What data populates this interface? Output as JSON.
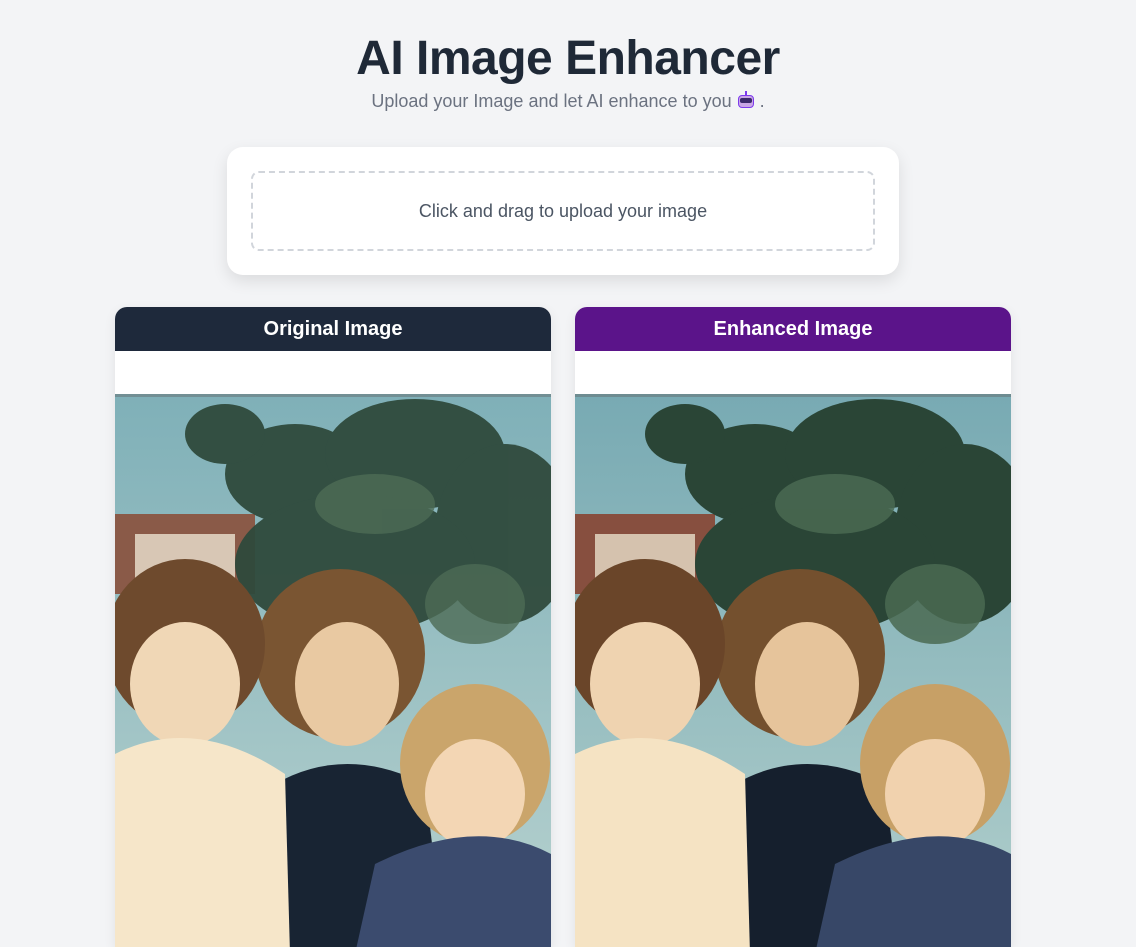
{
  "header": {
    "title": "AI Image Enhancer",
    "subtitle": "Upload your Image and let AI enhance to you",
    "subtitle_suffix": ".",
    "subtitle_icon": "robot-icon"
  },
  "upload": {
    "label": "Click and drag to upload your image"
  },
  "panels": {
    "original": {
      "title": "Original Image",
      "header_color": "#1e293b"
    },
    "enhanced": {
      "title": "Enhanced Image",
      "header_color": "#5b148a"
    }
  },
  "colors": {
    "background": "#f3f4f6",
    "title": "#1f2937",
    "subtitle": "#6b7280"
  }
}
